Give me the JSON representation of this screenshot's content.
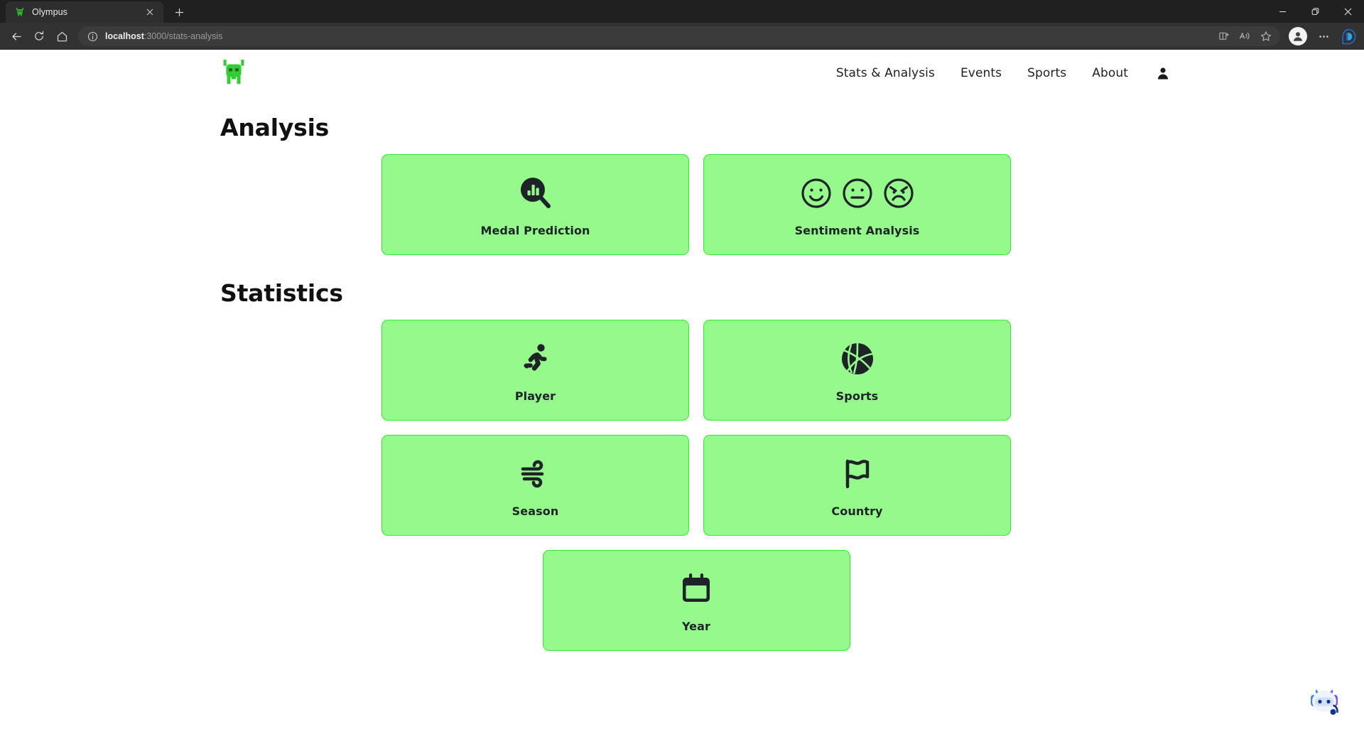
{
  "browser": {
    "tab": {
      "title": "Olympus",
      "favicon_icon": "alien-favicon",
      "close_icon": "close-icon"
    },
    "newtab_icon": "new-tab-icon",
    "window_controls": {
      "minimize_icon": "minimize-icon",
      "maximize_icon": "restore-icon",
      "close_icon": "window-close-icon"
    },
    "toolbar": {
      "back_icon": "back-arrow-icon",
      "refresh_icon": "refresh-icon",
      "home_icon": "home-icon",
      "info_icon": "site-info-icon",
      "url_host": "localhost",
      "url_path": ":3000/stats-analysis",
      "split_screen_icon": "split-screen-icon",
      "read_aloud_icon": "read-aloud-icon",
      "favorite_icon": "star-icon",
      "profile_icon": "profile-avatar-icon",
      "settings_icon": "more-options-icon",
      "copilot_icon": "copilot-icon"
    }
  },
  "site": {
    "logo_icon": "alien-logo-icon",
    "nav": [
      {
        "label": "Stats & Analysis",
        "name": "nav-stats-analysis"
      },
      {
        "label": "Events",
        "name": "nav-events"
      },
      {
        "label": "Sports",
        "name": "nav-sports"
      },
      {
        "label": "About",
        "name": "nav-about"
      }
    ],
    "account_icon": "user-account-icon"
  },
  "sections": {
    "analysis": {
      "title": "Analysis",
      "cards": [
        {
          "label": "Medal Prediction",
          "icon": "chart-search-icon"
        },
        {
          "label": "Sentiment Analysis",
          "icon": "sentiment-faces-icon"
        }
      ]
    },
    "statistics": {
      "title": "Statistics",
      "cards_row1": [
        {
          "label": "Player",
          "icon": "running-person-icon"
        },
        {
          "label": "Sports",
          "icon": "volleyball-icon"
        }
      ],
      "cards_row2": [
        {
          "label": "Season",
          "icon": "wind-icon"
        },
        {
          "label": "Country",
          "icon": "flag-icon"
        }
      ],
      "cards_row3": [
        {
          "label": "Year",
          "icon": "calendar-icon"
        }
      ]
    }
  },
  "widgets": {
    "chatbot_icon": "chatbot-assistant-icon"
  },
  "colors": {
    "card_fill": "#96F98B",
    "card_border": "#2ef02e",
    "icon_dark": "#1e2328",
    "logo_green": "#33cc33"
  }
}
